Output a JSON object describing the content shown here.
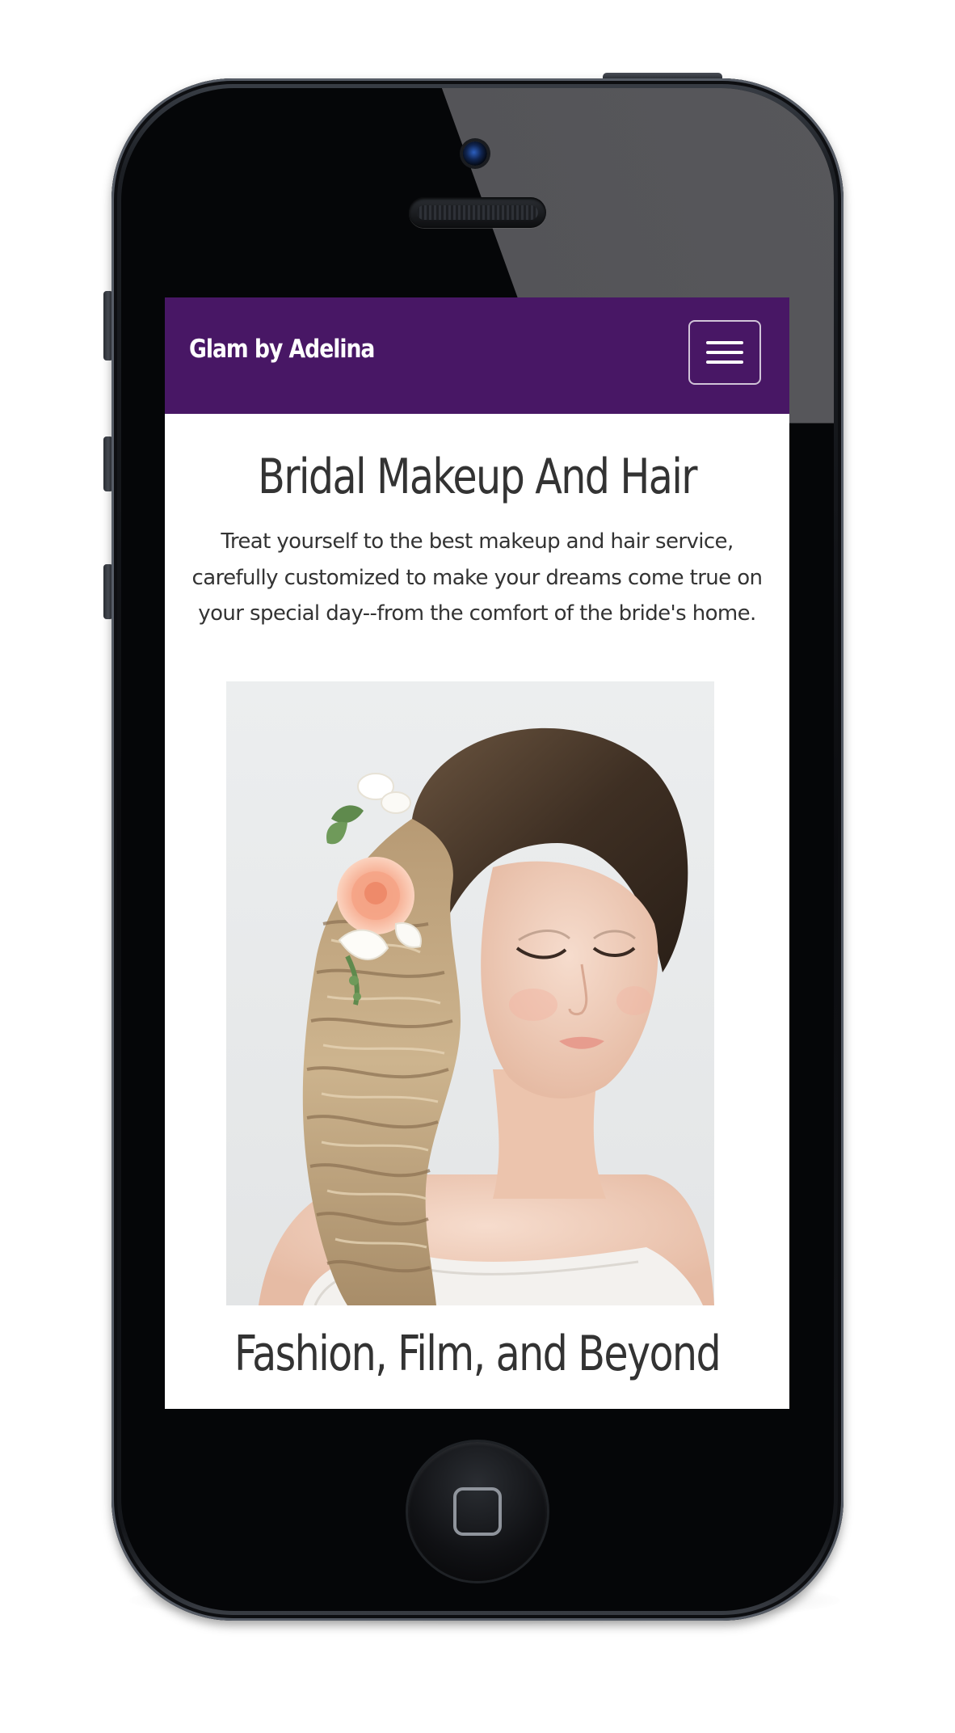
{
  "navbar": {
    "brand": "Glam by Adelina",
    "menu_icon": "hamburger-menu-icon",
    "background_color": "#481765"
  },
  "main": {
    "headline": "Bridal Makeup And Hair",
    "intro": "Treat yourself to the best makeup and hair service, carefully customized to make your dreams come true on your special day--from the comfort of the bride's home.",
    "hero_image": "bride-with-flower-hair-photo",
    "section_heading": "Fashion, Film, and Beyond"
  },
  "device": {
    "home_button_icon": "home-button-icon",
    "camera_icon": "front-camera-icon",
    "speaker_icon": "earpiece-speaker-icon"
  }
}
